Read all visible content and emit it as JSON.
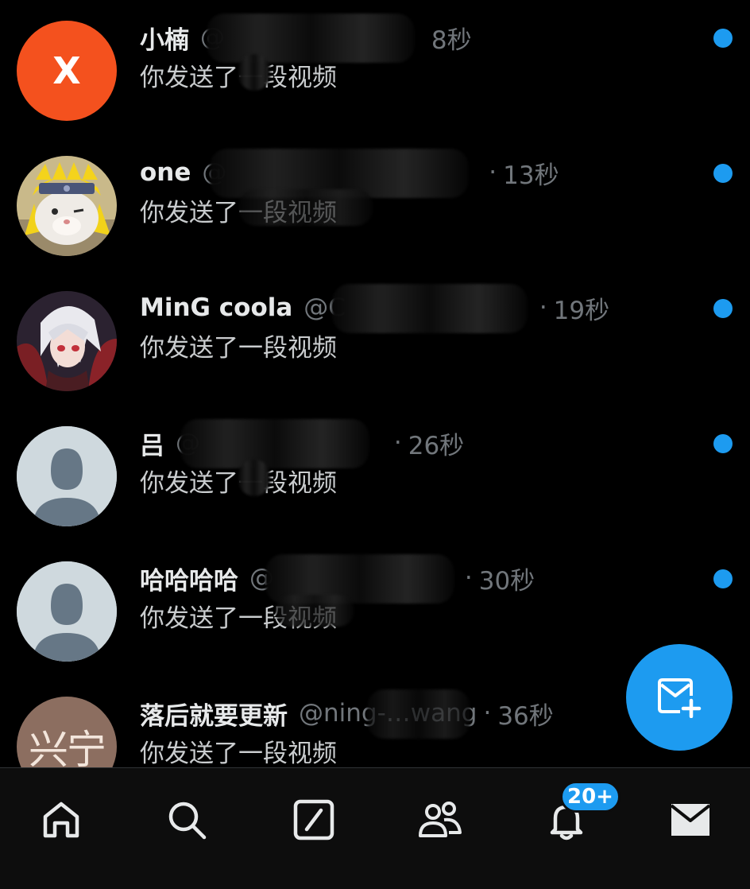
{
  "messages": [
    {
      "name": "小楠",
      "handle": "@",
      "time": "8秒",
      "preview": "你发送了一段视频",
      "avatar_letter": "X",
      "avatar_color": "#f4511e",
      "unread": true
    },
    {
      "name": "one",
      "handle": "@",
      "time": "13秒",
      "preview": "你发送了一段视频",
      "avatar_icon": "cat-avatar-icon",
      "unread": true
    },
    {
      "name": "MinG coola",
      "handle": "@C",
      "time": "19秒",
      "preview": "你发送了一段视频",
      "avatar_icon": "anime-avatar-icon",
      "unread": true
    },
    {
      "name": "吕",
      "handle": "@",
      "time": "26秒",
      "preview": "你发送了一段视频",
      "avatar_icon": "default-avatar-icon",
      "unread": true
    },
    {
      "name": "哈哈哈哈",
      "handle": "@",
      "time": "30秒",
      "preview": "你发送了一段视频",
      "avatar_icon": "default-avatar-icon",
      "unread": true
    },
    {
      "name": "落后就要更新",
      "handle": "@ning-…wang",
      "time": "36秒",
      "preview": "你发送了一段视频",
      "avatar_text": "兴宁",
      "avatar_color": "#8c6e60",
      "unread": false
    }
  ],
  "separator": "·",
  "fab": {
    "icon": "new-message-icon"
  },
  "tabbar": {
    "items": [
      "home-icon",
      "search-icon",
      "grok-icon",
      "communities-icon",
      "notifications-icon",
      "messages-icon"
    ],
    "notification_badge": "20+"
  },
  "colors": {
    "accent": "#1d9bf0",
    "background": "#000000",
    "secondary_text": "#71767b"
  }
}
